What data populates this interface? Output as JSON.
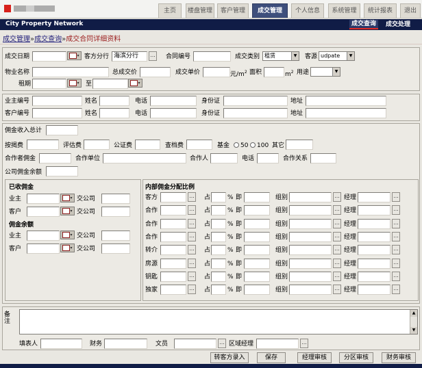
{
  "header": {
    "tabs": [
      "主页",
      "楼盘管理",
      "客户管理",
      "成交管理",
      "个人信息",
      "系统管理",
      "统计报表",
      "退出"
    ],
    "active_tab": "成交管理"
  },
  "nav": {
    "brand": "City Property Network",
    "subtabs": [
      "成交查询",
      "成交处理"
    ]
  },
  "breadcrumb": {
    "link1": "成交管理",
    "sep": "»",
    "link2": "成交查询",
    "current": "成交合同详细资料"
  },
  "row1": {
    "deal_date": "成交日期",
    "branch": "客方分行",
    "branch_value": "海滨分行",
    "contract_no": "合同编号",
    "deal_type": "成交类别",
    "deal_type_value": "租赁",
    "source": "客源",
    "source_value": "udpate"
  },
  "row2": {
    "property_name": "物业名称",
    "total_price": "总成交价",
    "unit_price": "成交单价",
    "unit_price_unit": "元/m",
    "sup2": "2",
    "area": "面积",
    "area_unit": "m",
    "usage": "用途",
    "lease_period": "租期",
    "to": "至"
  },
  "owner": {
    "owner_no": "业主编号",
    "name": "姓名",
    "phone": "电话",
    "id_card": "身份证",
    "address": "地址"
  },
  "client": {
    "client_no": "客户编号",
    "name": "姓名",
    "phone": "电话",
    "id_card": "身份证",
    "address": "地址"
  },
  "commission": {
    "total_income": "佣金收入总计",
    "mortgage_fee": "按揭费",
    "eval_fee": "评估费",
    "notary_fee": "公证费",
    "archive_fee": "查档费",
    "fund": "基金",
    "opt50": "50",
    "opt100": "100",
    "other": "其它",
    "partner_comm": "合作者佣金",
    "partner_unit": "合作单位",
    "partner": "合作人",
    "phone": "电话",
    "relation": "合作关系",
    "company_balance": "公司佣金余额"
  },
  "received": {
    "title": "已收佣金",
    "owner": "业主",
    "client": "客户",
    "paid": "交公司"
  },
  "balance": {
    "title": "佣金余额",
    "owner": "业主",
    "client": "客户",
    "paid": "交公司"
  },
  "internal": {
    "title": "内部佣金分配比例",
    "rows": [
      "客方",
      "合作",
      "合作",
      "合作",
      "转介",
      "房源",
      "钥匙",
      "独家"
    ],
    "percent_of": "占",
    "pct": "%",
    "equals": "即",
    "group": "组别",
    "manager": "经理"
  },
  "remark": {
    "label": "备注"
  },
  "footer": {
    "filler": "填表人",
    "finance": "财务",
    "clerk": "文员",
    "area_manager": "区域经理"
  },
  "buttons": [
    "转客方录入",
    "保存",
    "经理审核",
    "分区审核",
    "财务审核"
  ]
}
